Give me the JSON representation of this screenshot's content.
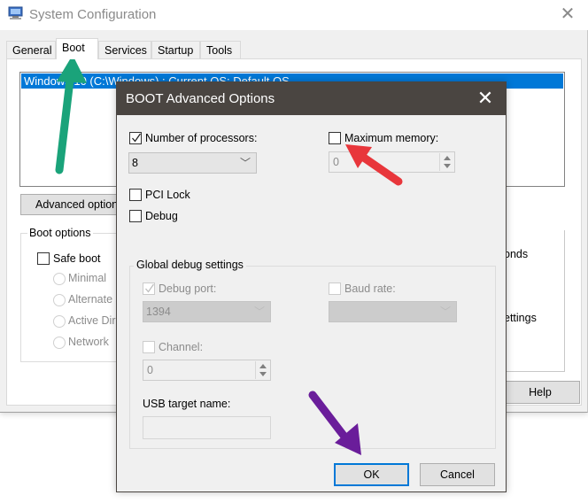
{
  "background_window": {
    "title": "System Configuration",
    "icon": "msconfig-computer-icon",
    "close_glyph": "✕",
    "tabs": [
      {
        "label": "General",
        "active": false
      },
      {
        "label": "Boot",
        "active": true
      },
      {
        "label": "Services",
        "active": false
      },
      {
        "label": "Startup",
        "active": false
      },
      {
        "label": "Tools",
        "active": false
      }
    ],
    "os_list": {
      "items": [
        {
          "label": "Windows 10 (C:\\Windows) : Current OS; Default OS",
          "selected": true
        }
      ]
    },
    "advanced_options_button": "Advanced options...",
    "boot_options": {
      "legend": "Boot options",
      "safe_boot": {
        "label": "Safe boot",
        "checked": false
      },
      "radios": [
        {
          "label": "Minimal",
          "enabled": false
        },
        {
          "label": "Alternate shell",
          "enabled": false
        },
        {
          "label": "Active Directory repair",
          "enabled": false
        },
        {
          "label": "Network",
          "enabled": false
        }
      ]
    },
    "partial_labels": {
      "timeout_seconds": "onds",
      "make_permanent": "ettings"
    },
    "help_button": "Help"
  },
  "dialog": {
    "title": "BOOT Advanced Options",
    "close_glyph": "✕",
    "number_of_processors": {
      "label": "Number of processors:",
      "checked": true,
      "value": "8"
    },
    "maximum_memory": {
      "label": "Maximum memory:",
      "checked": false,
      "value": "0"
    },
    "pci_lock": {
      "label": "PCI Lock",
      "checked": false
    },
    "debug": {
      "label": "Debug",
      "checked": false
    },
    "global_debug_settings": {
      "legend": "Global debug settings",
      "debug_port": {
        "label": "Debug port:",
        "checked": true,
        "enabled": false,
        "value": "1394"
      },
      "baud_rate": {
        "label": "Baud rate:",
        "checked": false,
        "enabled": false,
        "value": ""
      },
      "channel": {
        "label": "Channel:",
        "checked": false,
        "enabled": false,
        "value": "0"
      },
      "usb_target_name": {
        "label": "USB target name:",
        "value": ""
      }
    },
    "ok_button": "OK",
    "cancel_button": "Cancel"
  },
  "annotations": {
    "arrow_colors": {
      "green": "#1aa37a",
      "red": "#e8363b",
      "purple": "#6a1d9a"
    },
    "arrows": [
      {
        "color": "green",
        "points_to": "Boot tab"
      },
      {
        "color": "red",
        "points_to": "Maximum memory checkbox"
      },
      {
        "color": "purple",
        "points_to": "OK button"
      }
    ]
  },
  "colors": {
    "selection_blue": "#0078d7",
    "dialog_titlebar": "#4a4541",
    "window_bg": "#f0f0f0"
  }
}
